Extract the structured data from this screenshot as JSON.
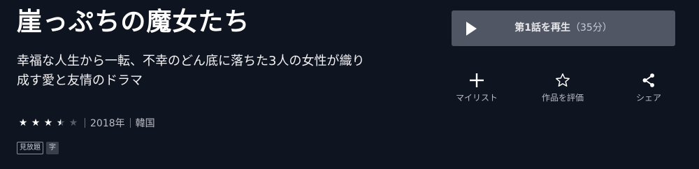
{
  "title": "崖っぷちの魔女たち",
  "description": "幸福な人生から一転、不幸のどん底に落ちた3人の女性が織り成す愛と友情のドラマ",
  "rating": {
    "stars": [
      "full",
      "full",
      "full",
      "half",
      "empty"
    ],
    "value": 3.5
  },
  "meta": {
    "year": "2018年",
    "country": "韓国"
  },
  "badges": {
    "unlimited": "見放題",
    "subtitle": "字"
  },
  "play": {
    "label": "第1話を再生",
    "duration": "（35分）"
  },
  "actions": {
    "mylist": "マイリスト",
    "rate": "作品を評価",
    "share": "シェア"
  },
  "colors": {
    "background": "#0f1421",
    "play_button": "#505663",
    "text": "#ffffff",
    "muted_text": "#b9bcc4"
  },
  "icons": {
    "play": "play-icon",
    "mylist": "plus-icon",
    "rate": "star-outline-icon",
    "share": "share-icon"
  }
}
